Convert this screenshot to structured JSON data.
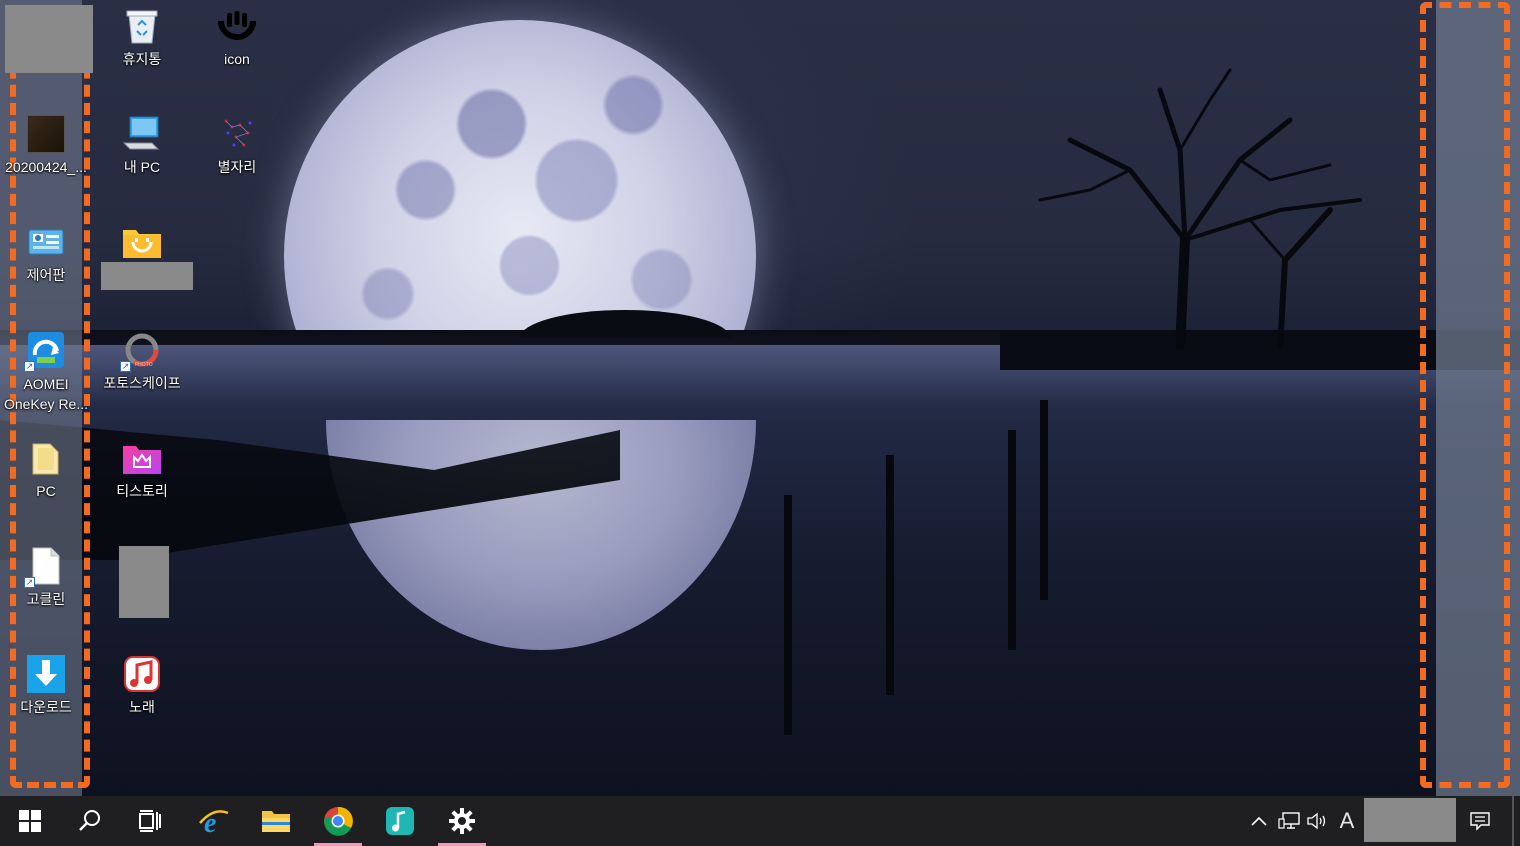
{
  "desktop": {
    "left_column": [
      {
        "label": "",
        "icon": "redacted-block"
      },
      {
        "label": "20200424_...",
        "icon": "image-file-icon"
      },
      {
        "label": "제어판",
        "icon": "control-panel-icon"
      },
      {
        "label": "AOMEI OneKey Re...",
        "icon": "aomei-onekey-icon"
      },
      {
        "label": "PC",
        "icon": "folder-icon"
      },
      {
        "label": "고클린",
        "icon": "document-shortcut-icon"
      },
      {
        "label": "다운로드",
        "icon": "download-icon"
      }
    ],
    "second_column": [
      {
        "label": "휴지통",
        "icon": "recycle-bin-icon"
      },
      {
        "label": "내 PC",
        "icon": "this-pc-icon"
      },
      {
        "label": "",
        "icon": "smile-folder-icon"
      },
      {
        "label": "포토스케이프",
        "icon": "photoscape-icon"
      },
      {
        "label": "티스토리",
        "icon": "tistory-folder-icon"
      },
      {
        "label": "",
        "icon": "redacted-block"
      },
      {
        "label": "노래",
        "icon": "music-note-icon"
      }
    ],
    "third_column": [
      {
        "label": "icon",
        "icon": "black-logo-icon"
      },
      {
        "label": "별자리",
        "icon": "constellation-icon"
      }
    ]
  },
  "taskbar": {
    "buttons": [
      {
        "name": "start",
        "icon": "windows-logo-icon"
      },
      {
        "name": "search",
        "icon": "search-icon"
      },
      {
        "name": "task-view",
        "icon": "task-view-icon"
      },
      {
        "name": "internet-explorer",
        "icon": "internet-explorer-icon"
      },
      {
        "name": "file-explorer",
        "icon": "file-explorer-icon"
      },
      {
        "name": "chrome",
        "icon": "chrome-icon"
      },
      {
        "name": "music-app",
        "icon": "music-app-icon"
      },
      {
        "name": "settings",
        "icon": "gear-icon"
      }
    ],
    "tray": {
      "chevron": "^",
      "ime": "A",
      "icons": [
        "show-hidden-icons-icon",
        "network-icon",
        "volume-icon",
        "notification-icon"
      ]
    }
  },
  "colors": {
    "highlight": "#f26b21",
    "taskbar": "#1f1f21",
    "active_underline": "#f29ab8",
    "redaction": "#8a8a8a"
  }
}
